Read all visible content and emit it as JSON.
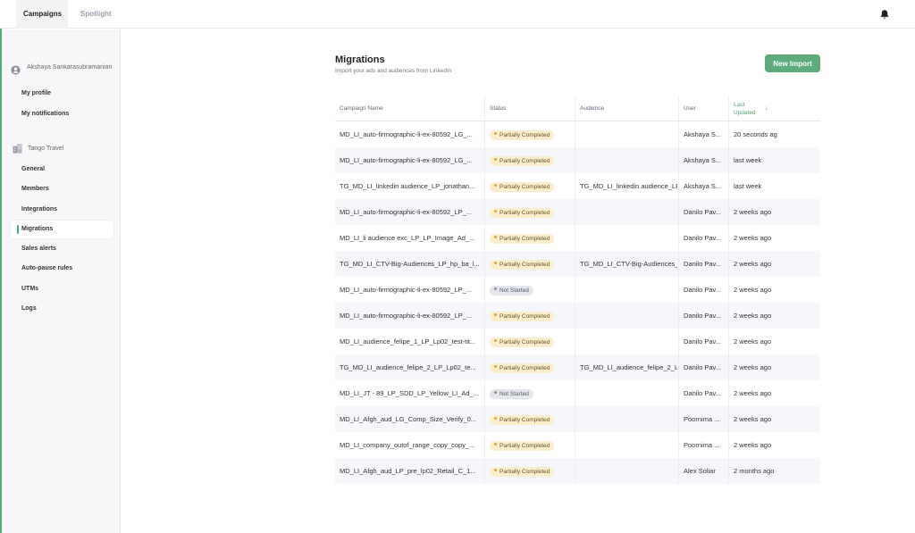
{
  "colors": {
    "accent": "#5eaa7c",
    "partial_bg": "#fbeecd",
    "not_started_bg": "#e4e6ec"
  },
  "topbar": {
    "tabs": [
      {
        "label": "Campaigns",
        "active": true
      },
      {
        "label": "Spotlight",
        "active": false
      }
    ],
    "notification_icon": "bell-icon"
  },
  "sidebar": {
    "user_icon": "user-circle-icon",
    "user_name": "Akshaya Sankarasubramanian",
    "user_links": [
      "My profile",
      "My notifications"
    ],
    "org_icon": "building-icon",
    "org_name": "Tango Travel",
    "items": [
      {
        "label": "General",
        "active": false
      },
      {
        "label": "Members",
        "active": false
      },
      {
        "label": "Integrations",
        "active": false
      },
      {
        "label": "Migrations",
        "active": true
      },
      {
        "label": "Sales alerts",
        "active": false
      },
      {
        "label": "Auto-pause rules",
        "active": false
      },
      {
        "label": "UTMs",
        "active": false
      },
      {
        "label": "Logs",
        "active": false
      }
    ]
  },
  "main": {
    "title": "Migrations",
    "subtitle": "Import your ads and audiences from LinkedIn",
    "new_import_label": "New Import",
    "columns": {
      "name": "Campaign Name",
      "status": "Status",
      "audience": "Audience",
      "user": "User",
      "updated_line1": "Last",
      "updated_line2": "Updated",
      "sort_icon": "arrow-down-icon"
    },
    "rows": [
      {
        "name": "MD_LI_auto-firmographic-li-ex-80592_LG_...",
        "status": "Partially Completed",
        "audience": "",
        "user": "Akshaya S...",
        "updated": "20 seconds ag"
      },
      {
        "name": "MD_LI_auto-firmographic-li-ex-80592_LG_...",
        "status": "Partially Completed",
        "audience": "",
        "user": "Akshaya S...",
        "updated": "last week"
      },
      {
        "name": "TG_MD_LI_linkedin audience_LP_jonathan...",
        "status": "Partially Completed",
        "audience": "TG_MD_LI_linkedin audience_LF",
        "user": "Akshaya S...",
        "updated": "last week"
      },
      {
        "name": "MD_LI_auto-firmographic-li-ex-80592_LP_...",
        "status": "Partially Completed",
        "audience": "",
        "user": "Danilo Pav...",
        "updated": "2 weeks ago"
      },
      {
        "name": "MD_LI_li audience exc_LP_LP_Image_Ad_...",
        "status": "Partially Completed",
        "audience": "",
        "user": "Danilo Pav...",
        "updated": "2 weeks ago"
      },
      {
        "name": "TG_MD_LI_CTV-Big-Audiences_LP_hp_ba_l...",
        "status": "Partially Completed",
        "audience": "TG_MD_LI_CTV-Big-Audiences_",
        "user": "Danilo Pav...",
        "updated": "2 weeks ago"
      },
      {
        "name": "MD_LI_auto-firmographic-li-ex-80592_LP_...",
        "status": "Not Started",
        "audience": "",
        "user": "Danilo Pav...",
        "updated": "2 weeks ago"
      },
      {
        "name": "MD_LI_auto-firmographic-li-ex-80592_LP_...",
        "status": "Partially Completed",
        "audience": "",
        "user": "Danilo Pav...",
        "updated": "2 weeks ago"
      },
      {
        "name": "MD_LI_audience_felipe_1_LP_Lp02_test-tit...",
        "status": "Partially Completed",
        "audience": "",
        "user": "Danilo Pav...",
        "updated": "2 weeks ago"
      },
      {
        "name": "TG_MD_LI_audience_felipe_2_LP_Lp02_te...",
        "status": "Partially Completed",
        "audience": "TG_MD_LI_audience_felipe_2_L",
        "user": "Danilo Pav...",
        "updated": "2 weeks ago"
      },
      {
        "name": "MD_LI_JT - 89_LP_SDD_LP_Yellow_LI_Ad_...",
        "status": "Not Started",
        "audience": "",
        "user": "Danilo Pav...",
        "updated": "2 weeks ago"
      },
      {
        "name": "MD_LI_Afgh_aud_LG_Comp_Size_Verify_0...",
        "status": "Partially Completed",
        "audience": "",
        "user": "Poornima ...",
        "updated": "2 weeks ago"
      },
      {
        "name": "MD_LI_company_outof_range_copy_copy_...",
        "status": "Partially Completed",
        "audience": "",
        "user": "Poornima ...",
        "updated": "2 weeks ago"
      },
      {
        "name": "MD_LI_Afgh_aud_LP_pre_lp02_Retail_C_1...",
        "status": "Partially Completed",
        "audience": "",
        "user": "Alex Soliar",
        "updated": "2 months ago"
      }
    ]
  }
}
